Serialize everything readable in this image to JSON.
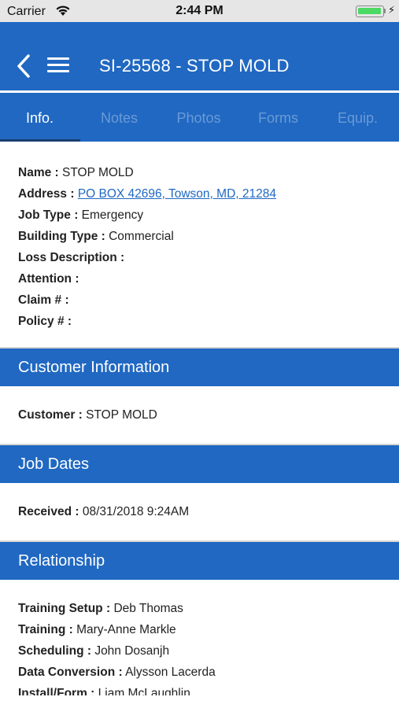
{
  "status_bar": {
    "carrier": "Carrier",
    "time": "2:44 PM",
    "battery_level": 1.0,
    "battery_color": "#4cd964"
  },
  "nav": {
    "title": "SI-25568 - STOP MOLD",
    "back_icon": "chevron-left-icon",
    "menu_icon": "hamburger-menu-icon",
    "bar_color": "#2068c2"
  },
  "tabs": [
    {
      "label": "Info.",
      "active": true
    },
    {
      "label": "Notes",
      "active": false
    },
    {
      "label": "Photos",
      "active": false
    },
    {
      "label": "Forms",
      "active": false
    },
    {
      "label": "Equip.",
      "active": false
    }
  ],
  "info": {
    "name": {
      "label": "Name :",
      "value": "STOP MOLD"
    },
    "address": {
      "label": "Address :",
      "value": "PO BOX 42696, Towson, MD, 21284"
    },
    "job_type": {
      "label": "Job Type :",
      "value": "Emergency"
    },
    "building_type": {
      "label": "Building Type :",
      "value": "Commercial"
    },
    "loss_description": {
      "label": "Loss Description :",
      "value": ""
    },
    "attention": {
      "label": "Attention :",
      "value": ""
    },
    "claim": {
      "label": "Claim # :",
      "value": ""
    },
    "policy": {
      "label": "Policy # :",
      "value": ""
    }
  },
  "customer_section": {
    "title": "Customer Information",
    "customer": {
      "label": "Customer :",
      "value": "STOP MOLD"
    }
  },
  "job_dates_section": {
    "title": "Job Dates",
    "received": {
      "label": "Received :",
      "value": "08/31/2018 9:24AM"
    }
  },
  "relationship_section": {
    "title": "Relationship",
    "rows": [
      {
        "label": "Training Setup :",
        "value": "Deb Thomas"
      },
      {
        "label": "Training :",
        "value": "Mary-Anne Markle"
      },
      {
        "label": "Scheduling :",
        "value": "John Dosanjh"
      },
      {
        "label": "Data Conversion :",
        "value": "Alysson Lacerda"
      },
      {
        "label": "Install/Form :",
        "value": "Liam McLaughlin"
      }
    ]
  }
}
